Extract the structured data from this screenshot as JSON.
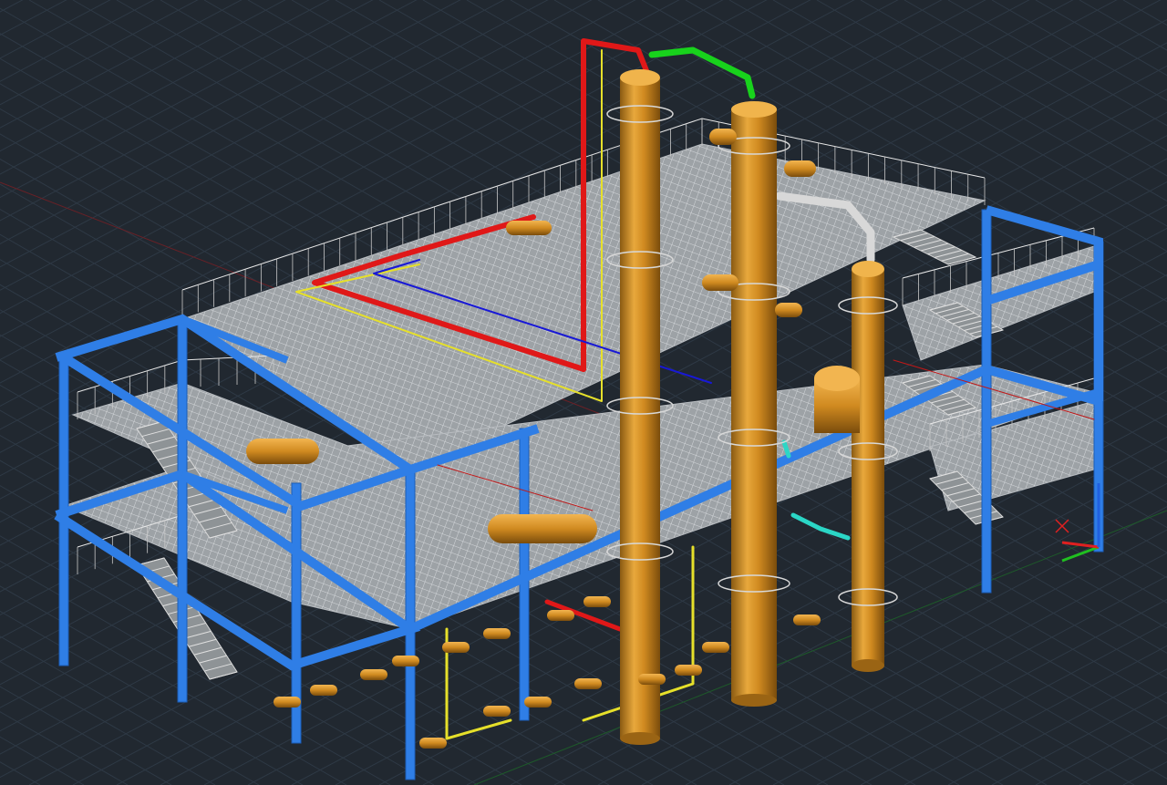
{
  "viewport": {
    "background": "#212830",
    "grid_color": "#2e3945",
    "model": {
      "structure_color": "#2f7ee6",
      "equipment_color": "#d89a34",
      "grating_color": "#b8bcc0",
      "handrail_color": "#e8e8e8",
      "pipe_colors": {
        "red": "#e01818",
        "green": "#18d21c",
        "yellow": "#e6e02a",
        "blue": "#1818d6",
        "cyan": "#2bd6c6",
        "white": "#d8d8d8"
      }
    },
    "ucs_icon": {
      "x_axis_color": "#e02020",
      "y_axis_color": "#20c020",
      "z_axis_color": "#2060e0"
    }
  }
}
